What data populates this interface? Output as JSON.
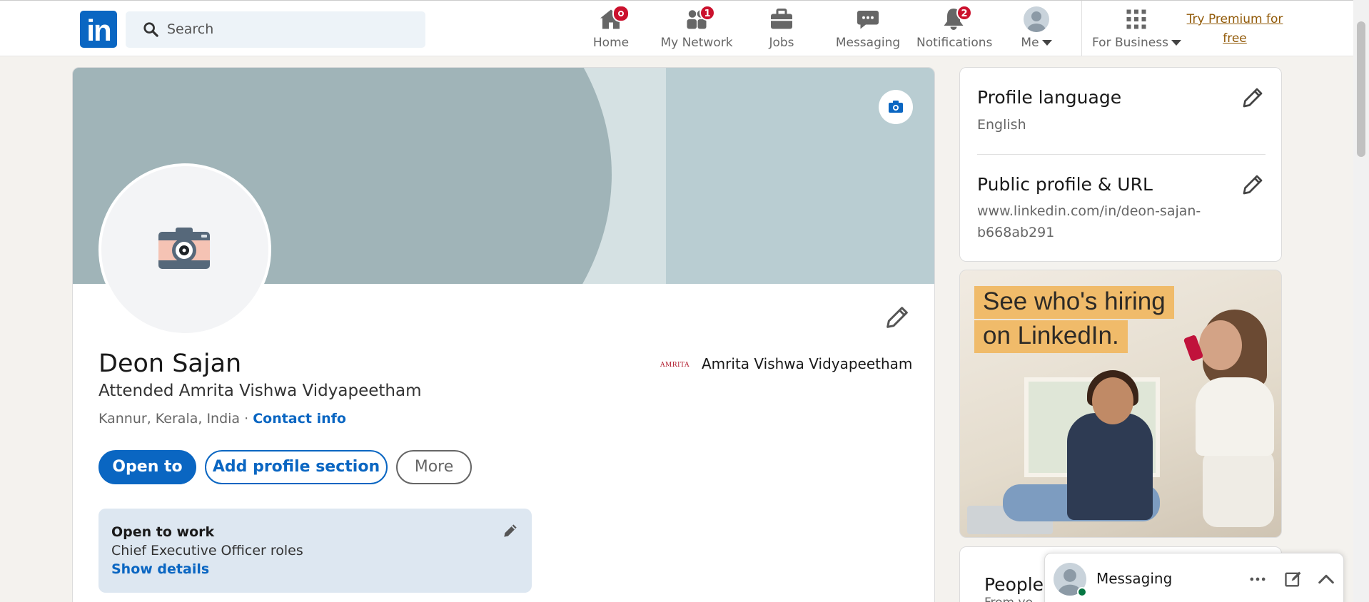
{
  "nav": {
    "logo_text": "in",
    "search_placeholder": "Search",
    "items": [
      {
        "label": "Home",
        "icon": "home-icon",
        "badge": ""
      },
      {
        "label": "My Network",
        "icon": "network-icon",
        "badge": "1"
      },
      {
        "label": "Jobs",
        "icon": "briefcase-icon",
        "badge": ""
      },
      {
        "label": "Messaging",
        "icon": "messaging-icon",
        "badge": ""
      },
      {
        "label": "Notifications",
        "icon": "bell-icon",
        "badge": "2"
      },
      {
        "label": "Me",
        "icon": "avatar-icon",
        "badge": ""
      },
      {
        "label": "For Business",
        "icon": "grid-icon",
        "badge": ""
      }
    ],
    "premium_line1": "Try Premium for",
    "premium_line2": "free"
  },
  "profile": {
    "name": "Deon Sajan",
    "headline": "Attended Amrita Vishwa Vidyapeetham",
    "location": "Kannur, Kerala, India",
    "separator": " · ",
    "contact_info": "Contact info",
    "school_logo_text": "AMRITA",
    "school": "Amrita Vishwa Vidyapeetham",
    "buttons": {
      "open_to": "Open to",
      "add_section": "Add profile section",
      "more": "More"
    },
    "open_to_work": {
      "title": "Open to work",
      "roles": "Chief Executive Officer roles",
      "link": "Show details"
    }
  },
  "sidebar": {
    "language_title": "Profile language",
    "language_value": "English",
    "url_title": "Public profile & URL",
    "url_line1": "www.linkedin.com/in/deon-sajan-",
    "url_line2": "b668ab291",
    "ad_line1": "See who's hiring",
    "ad_line2": "on LinkedIn.",
    "people_title": "People y",
    "people_sub": "From yo"
  },
  "messaging": {
    "label": "Messaging"
  },
  "colors": {
    "brand": "#0a66c2",
    "badge": "#cb112d",
    "premium": "#915907",
    "online": "#057642"
  }
}
